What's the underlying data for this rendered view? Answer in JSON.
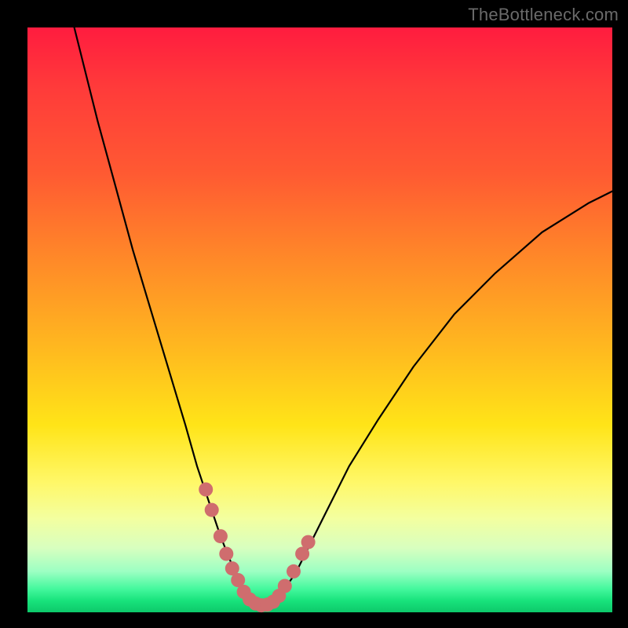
{
  "watermark": "TheBottleneck.com",
  "colors": {
    "frame": "#000000",
    "curve_stroke": "#000000",
    "marker_fill": "#cf6d6e",
    "watermark_text": "#6a6a6a"
  },
  "chart_data": {
    "type": "line",
    "title": "",
    "xlabel": "",
    "ylabel": "",
    "xlim": [
      0,
      100
    ],
    "ylim": [
      0,
      100
    ],
    "grid": false,
    "series": [
      {
        "name": "bottleneck-curve",
        "x": [
          8,
          10,
          12,
          15,
          18,
          21,
          24,
          27,
          29,
          31,
          33,
          35,
          36,
          37,
          38,
          39,
          40,
          41,
          42,
          43,
          44,
          46,
          48,
          51,
          55,
          60,
          66,
          73,
          80,
          88,
          96,
          100
        ],
        "y": [
          100,
          92,
          84,
          73,
          62,
          52,
          42,
          32,
          25,
          19,
          13,
          8,
          6,
          4,
          2.5,
          1.5,
          1,
          1,
          1.5,
          2.5,
          4,
          7,
          11,
          17,
          25,
          33,
          42,
          51,
          58,
          65,
          70,
          72
        ]
      }
    ],
    "markers": [
      {
        "x": 30.5,
        "y": 21
      },
      {
        "x": 31.5,
        "y": 17.5
      },
      {
        "x": 33,
        "y": 13
      },
      {
        "x": 34,
        "y": 10
      },
      {
        "x": 35,
        "y": 7.5
      },
      {
        "x": 36,
        "y": 5.5
      },
      {
        "x": 37,
        "y": 3.5
      },
      {
        "x": 38,
        "y": 2.2
      },
      {
        "x": 39,
        "y": 1.5
      },
      {
        "x": 40,
        "y": 1.2
      },
      {
        "x": 41,
        "y": 1.3
      },
      {
        "x": 42,
        "y": 1.8
      },
      {
        "x": 43,
        "y": 2.8
      },
      {
        "x": 44,
        "y": 4.5
      },
      {
        "x": 45.5,
        "y": 7
      },
      {
        "x": 47,
        "y": 10
      },
      {
        "x": 48,
        "y": 12
      }
    ]
  }
}
